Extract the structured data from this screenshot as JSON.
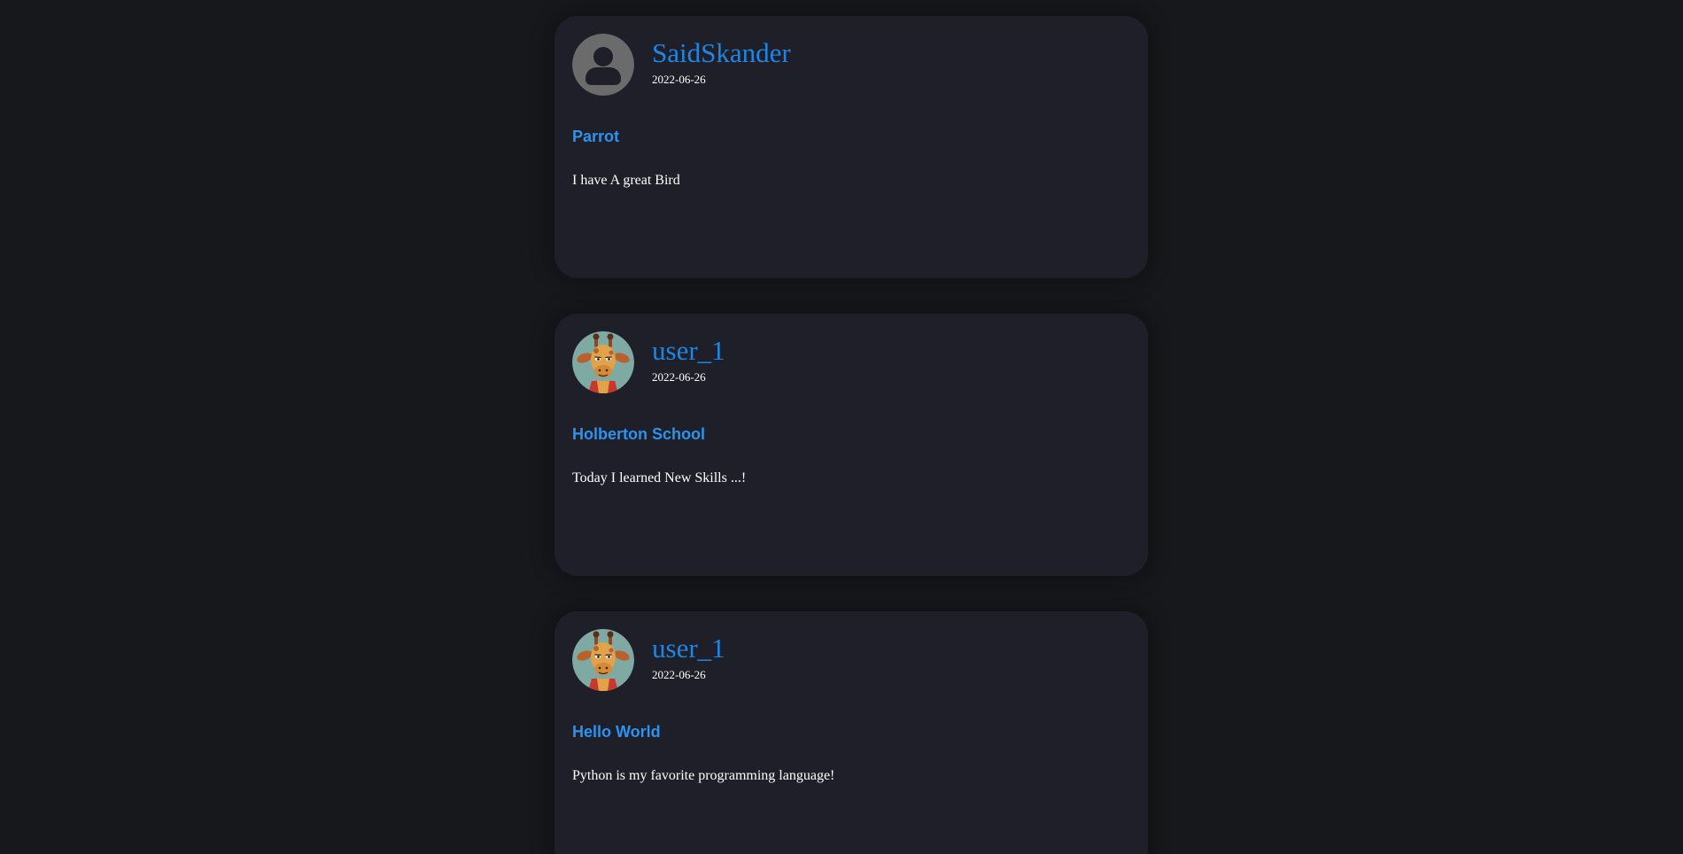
{
  "posts": [
    {
      "username": "SaidSkander",
      "date": "2022-06-26",
      "title": "Parrot",
      "body": "I have A great Bird",
      "avatar_icon": "default-user-avatar"
    },
    {
      "username": "user_1",
      "date": "2022-06-26",
      "title": "Holberton School",
      "body": "Today I learned New Skills ...!",
      "avatar_icon": "giraffe-avatar"
    },
    {
      "username": "user_1",
      "date": "2022-06-26",
      "title": "Hello World",
      "body": "Python is my favorite programming language!",
      "avatar_icon": "giraffe-avatar"
    }
  ],
  "colors": {
    "page_background": "#17181b",
    "card_background": "#1e1f29",
    "username": "#1e86e3",
    "title": "#2b93f0",
    "text": "#ffffff"
  }
}
